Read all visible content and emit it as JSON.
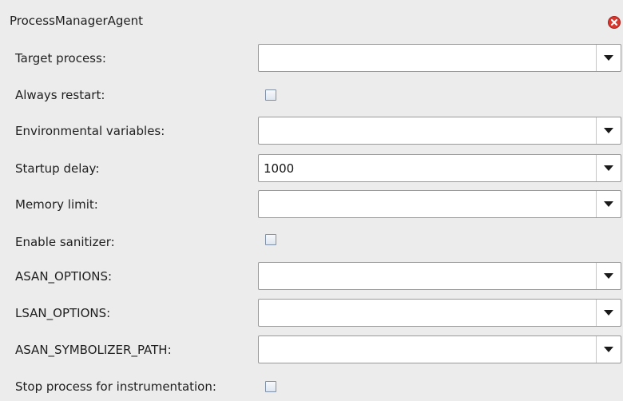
{
  "window": {
    "title": "ProcessManagerAgent",
    "close_icon": "close-icon",
    "close_color": "#e0322a"
  },
  "fields": {
    "target_process": {
      "label": "Target process:",
      "value": ""
    },
    "always_restart": {
      "label": "Always restart:",
      "checked": false
    },
    "environmental_variables": {
      "label": "Environmental variables:",
      "value": ""
    },
    "startup_delay": {
      "label": "Startup delay:",
      "value": "1000"
    },
    "memory_limit": {
      "label": "Memory limit:",
      "value": ""
    },
    "enable_sanitizer": {
      "label": "Enable sanitizer:",
      "checked": false
    },
    "asan_options": {
      "label": "ASAN_OPTIONS:",
      "value": ""
    },
    "lsan_options": {
      "label": "LSAN_OPTIONS:",
      "value": ""
    },
    "asan_symbolizer_path": {
      "label": "ASAN_SYMBOLIZER_PATH:",
      "value": ""
    },
    "stop_process_for_instrumentation": {
      "label": "Stop process for instrumentation:",
      "checked": false
    }
  },
  "icons": {
    "dropdown": "chevron-down-icon",
    "checkbox": "checkbox-icon"
  }
}
